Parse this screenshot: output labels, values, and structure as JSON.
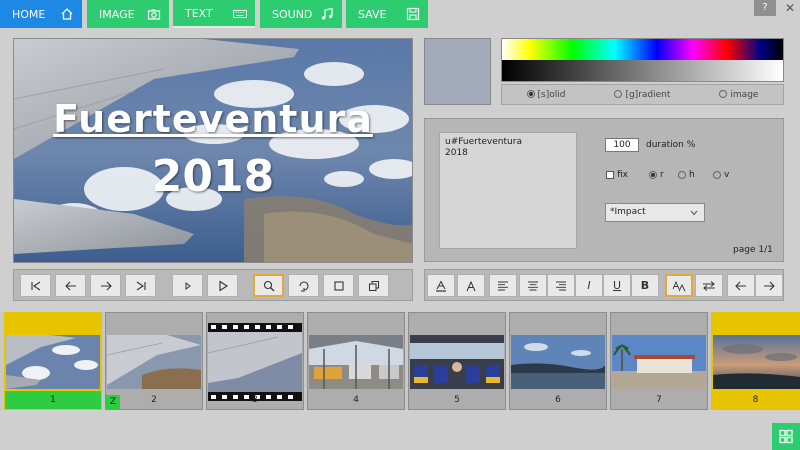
{
  "tabs": {
    "home": "HOME",
    "image": "IMAGE",
    "text": "TEXT",
    "sound": "SOUND",
    "save": "SAVE"
  },
  "window": {
    "help": "?",
    "close": "✕"
  },
  "preview": {
    "line1": "Fuerteventura",
    "line2": "2018"
  },
  "background": {
    "swatch_color": "#a3aab9",
    "options": [
      "[s]olid",
      "[g]radient",
      "image"
    ],
    "selected": "[s]olid"
  },
  "text_panel": {
    "content": "u#Fuerteventura\n2018",
    "duration_value": "100",
    "duration_label": "duration %",
    "fix_label": "fix",
    "align_options": [
      "r",
      "h",
      "v"
    ],
    "align_selected": "r",
    "font": "*Impact",
    "page_info": "page 1/1"
  },
  "playback_buttons": [
    "skip-first",
    "previous",
    "next",
    "skip-last",
    "play",
    "play-outline",
    "zoom",
    "rotate",
    "crop",
    "copy"
  ],
  "text_buttons": [
    "underline-a",
    "a-plain",
    "align-left",
    "align-center",
    "align-right",
    "italic",
    "underline",
    "bold",
    "font-size",
    "swap",
    "undo",
    "redo"
  ],
  "text_button_labels": {
    "italic": "I",
    "underline": "U",
    "bold": "B"
  },
  "thumbnails": [
    {
      "number": "1",
      "top_color": "#e6c400",
      "bottom_color": "#2ecc40"
    },
    {
      "number": "2",
      "badge": "Z"
    },
    {
      "number": "3"
    },
    {
      "number": "4"
    },
    {
      "number": "5"
    },
    {
      "number": "6"
    },
    {
      "number": "7"
    },
    {
      "number": "8",
      "top_color": "#e6c400",
      "bottom_color": "#e6c400"
    }
  ],
  "colors": {
    "home_blue": "#1e88e5",
    "tab_green": "#2ecc71",
    "selected_yellow": "#e6c400",
    "selected_green": "#2ecc40",
    "highlight_orange": "#e2a93c"
  }
}
